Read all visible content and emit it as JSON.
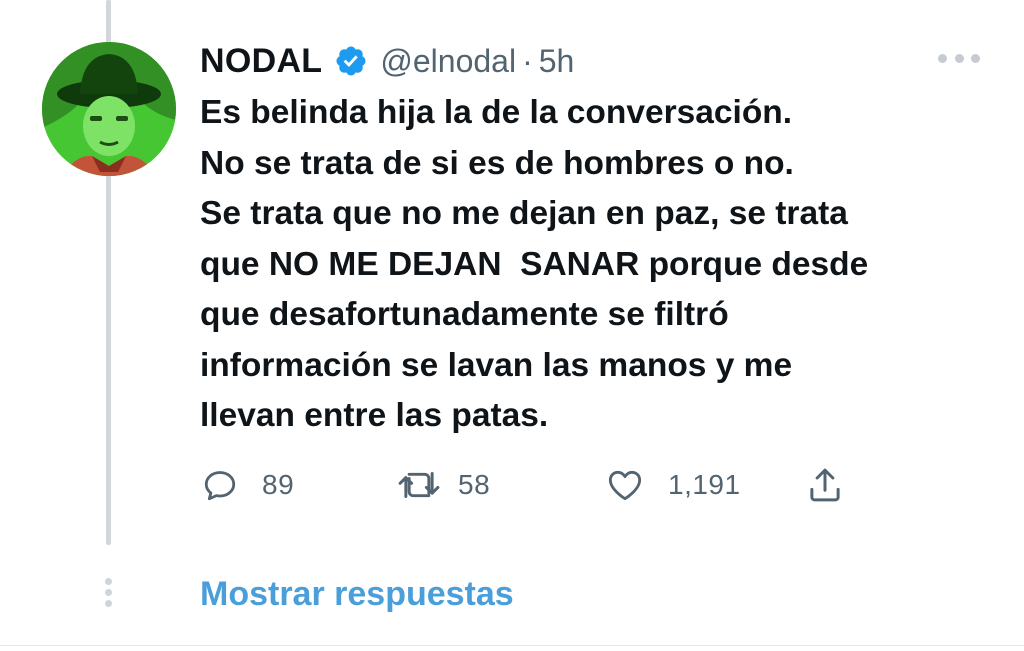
{
  "tweet": {
    "author": {
      "name": "NODAL",
      "handle": "@elnodal",
      "verified": true
    },
    "separator": "·",
    "time": "5h",
    "lines": [
      "Es belinda hija la de la conversación.",
      "No se trata de si es de hombres o no.",
      "Se trata que no me dejan en paz, se trata",
      "que NO ME DEJAN  SANAR porque desde",
      "que desafortunadamente se filtró",
      "información se lavan las manos y me",
      "llevan entre las patas."
    ],
    "stats": {
      "replies": "89",
      "retweets": "58",
      "likes": "1,191"
    }
  },
  "thread": {
    "show_replies_label": "Mostrar respuestas"
  },
  "colors": {
    "text": "#0f1419",
    "secondary": "#536471",
    "link": "#4a9fdb",
    "verified_badge": "#1d9bf0",
    "avatar_tint": "#4cd136"
  },
  "icons": [
    "verified-badge-icon",
    "more-options-icon",
    "reply-icon",
    "retweet-icon",
    "like-icon",
    "share-icon"
  ]
}
